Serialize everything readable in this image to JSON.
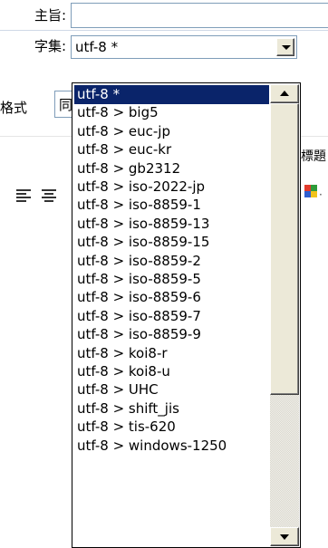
{
  "subject": {
    "label": "主旨:",
    "value": ""
  },
  "charset": {
    "label": "字集:",
    "selected": "utf-8 *",
    "options": [
      "utf-8 *",
      "utf-8 > big5",
      "utf-8 > euc-jp",
      "utf-8 > euc-kr",
      "utf-8 > gb2312",
      "utf-8 > iso-2022-jp",
      "utf-8 > iso-8859-1",
      "utf-8 > iso-8859-13",
      "utf-8 > iso-8859-15",
      "utf-8 > iso-8859-2",
      "utf-8 > iso-8859-5",
      "utf-8 > iso-8859-6",
      "utf-8 > iso-8859-7",
      "utf-8 > iso-8859-9",
      "utf-8 > koi8-r",
      "utf-8 > koi8-u",
      "utf-8 > UHC",
      "utf-8 > shift_jis",
      "utf-8 > tis-620",
      "utf-8 > windows-1250"
    ]
  },
  "background": {
    "format_label": "格式",
    "format_value": "同",
    "header_fragment": "標題",
    "color_tail": "·"
  },
  "icons": {
    "dropdown": "chevron-down-icon",
    "scroll_up": "arrow-up-icon",
    "scroll_down": "arrow-down-icon",
    "align_left": "align-left-icon",
    "align_center": "align-center-icon",
    "text_color": "text-color-icon"
  },
  "colors": {
    "selection": "#0a246a",
    "border": "#7f9db9",
    "button_face": "#ece9d8"
  }
}
